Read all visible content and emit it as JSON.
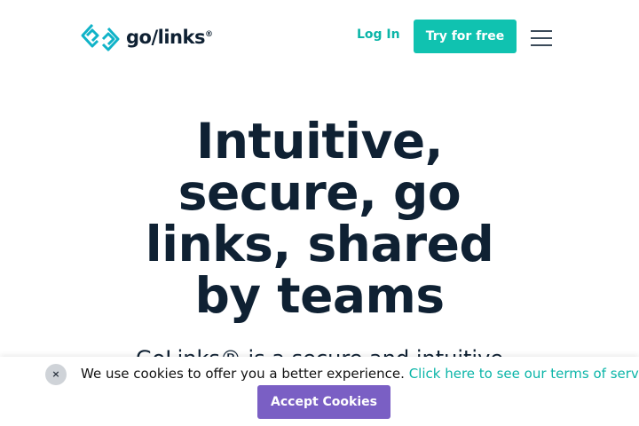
{
  "header": {
    "logo_text": "go/links",
    "logo_mark": "®",
    "login_label": "Log In",
    "try_label": "Try for free",
    "menu_icon": "hamburger-menu-icon"
  },
  "hero": {
    "title": "Intuitive, secure, go links, shared by teams",
    "subtitle": "GoLinks® is a secure and intuitive"
  },
  "cookie": {
    "close_symbol": "×",
    "message": "We use cookies to offer you a better experience.",
    "link_text": "Click here to see our terms of service.",
    "accept_label": "Accept Cookies"
  },
  "colors": {
    "accent_teal": "#10c2b0",
    "accept_purple": "#7a5fc4",
    "text_dark": "#0f2133"
  }
}
